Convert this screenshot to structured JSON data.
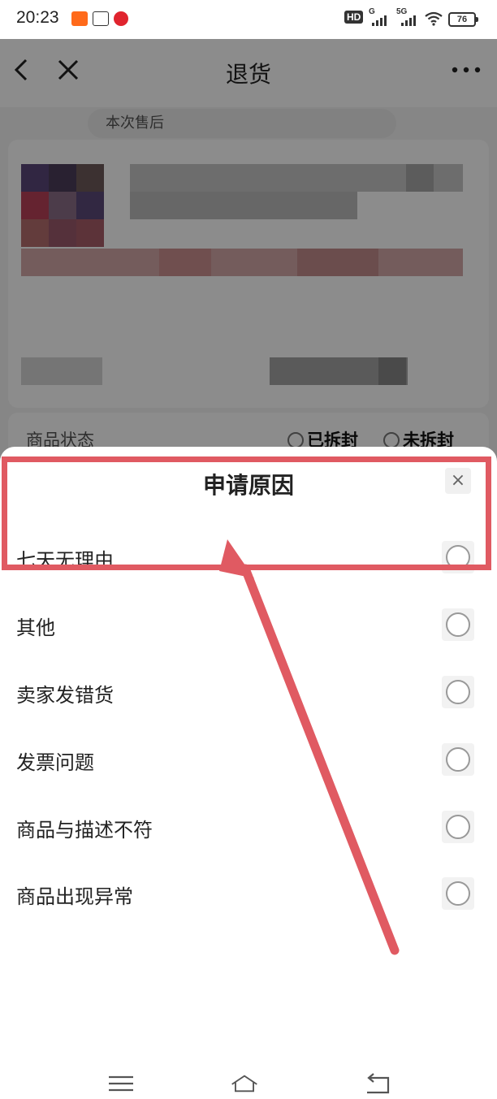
{
  "status_bar": {
    "time": "20:23",
    "network_hd": "HD",
    "network_g": "G",
    "network_5g": "5G",
    "battery": "76"
  },
  "navbar": {
    "title": "退货"
  },
  "order": {
    "tip": "本次售后",
    "status_label": "商品状态",
    "status_options": [
      "已拆封",
      "未拆封"
    ]
  },
  "sheet": {
    "title": "申请原因",
    "close": "×",
    "reasons": [
      "七天无理由",
      "其他",
      "卖家发错货",
      "发票问题",
      "商品与描述不符",
      "商品出现异常"
    ]
  },
  "colors": {
    "annotation": "#e05a62",
    "overlay": "rgba(0,0,0,0.45)"
  },
  "icons": {
    "back": "chevron-left-icon",
    "close": "close-icon",
    "more": "more-dots-icon",
    "menu": "menu-icon",
    "home": "home-icon",
    "return": "return-icon"
  }
}
